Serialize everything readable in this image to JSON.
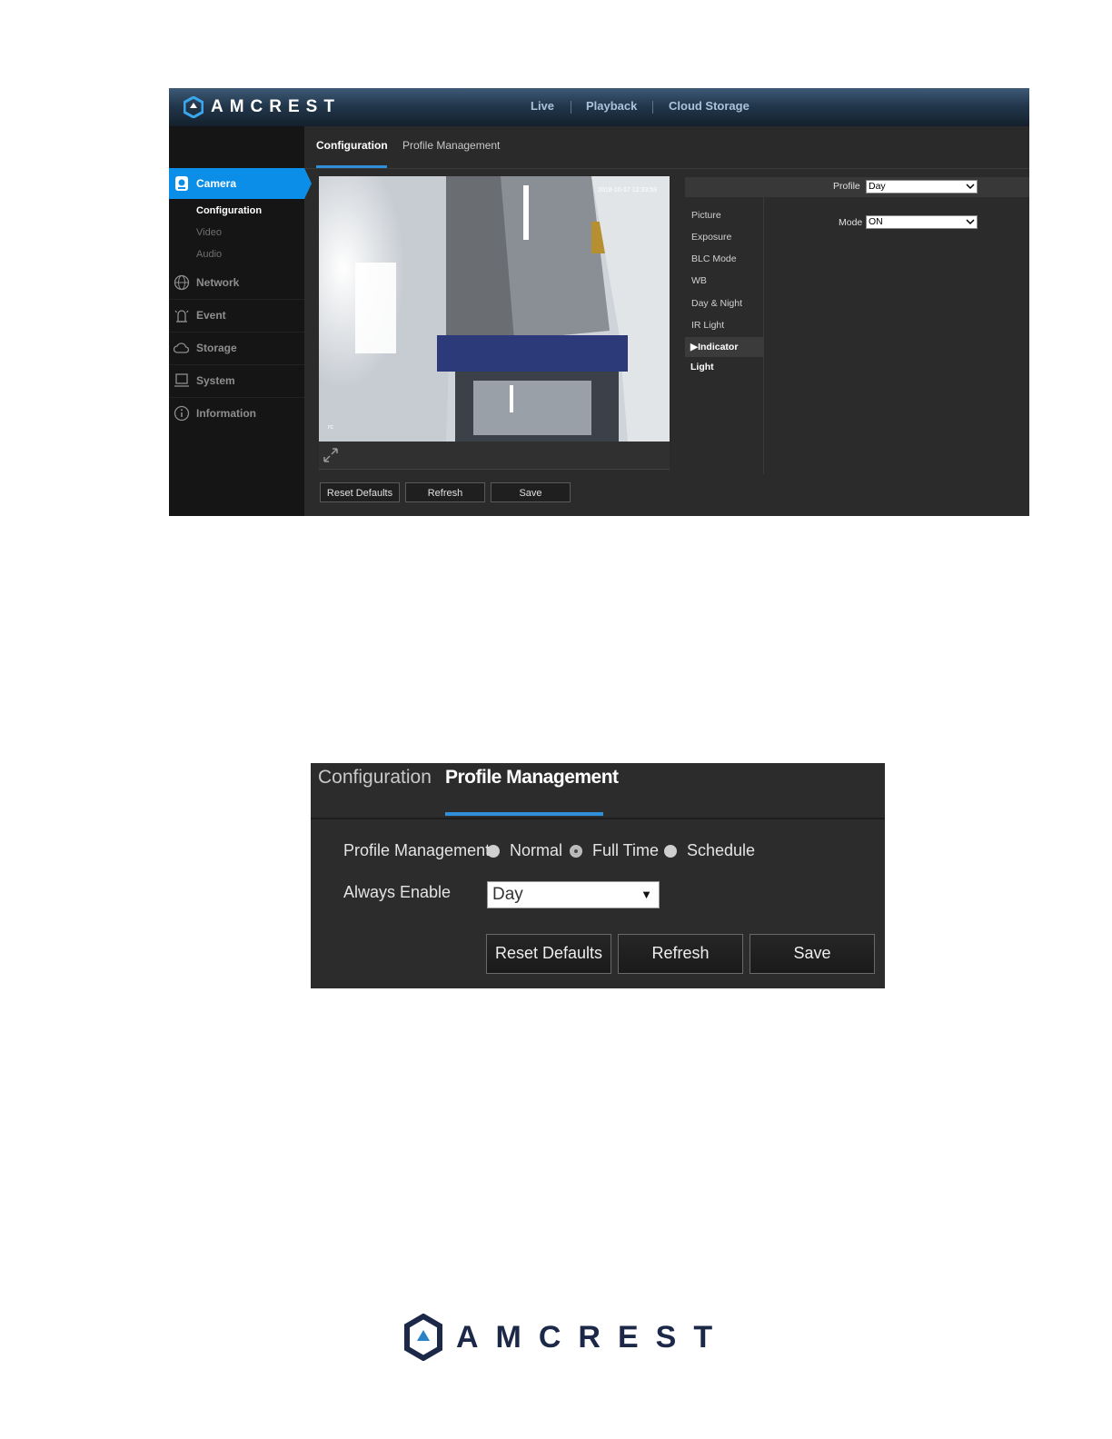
{
  "brand": {
    "name": "AMCREST"
  },
  "screenshot1": {
    "topnav": [
      "Live",
      "Playback",
      "Cloud Storage"
    ],
    "subtabs": {
      "configuration": "Configuration",
      "profile_management": "Profile Management"
    },
    "leftnav": {
      "camera": "Camera",
      "camera_subitems": [
        "Configuration",
        "Video",
        "Audio"
      ],
      "network": "Network",
      "event": "Event",
      "storage": "Storage",
      "system": "System",
      "information": "Information"
    },
    "preview": {
      "timestamp": "2018-10-17 12:33:53",
      "channel_label": "rc"
    },
    "buttons": {
      "reset": "Reset Defaults",
      "refresh": "Refresh",
      "save": "Save"
    },
    "settings": {
      "profile_label": "Profile",
      "profile_value": "Day",
      "items": [
        "Picture",
        "Exposure",
        "BLC Mode",
        "WB",
        "Day & Night",
        "IR Light",
        "Indicator Light"
      ],
      "active_item_prefix": "▶",
      "mode_label": "Mode",
      "mode_value": "ON"
    },
    "colors": {
      "accent": "#0b8ee8",
      "tab_underline": "#2f8fd8"
    }
  },
  "screenshot2": {
    "tabs": {
      "configuration": "Configuration",
      "profile_management": "Profile Management"
    },
    "profile_management_label": "Profile Management",
    "radio_options": [
      "Normal",
      "Full Time",
      "Schedule"
    ],
    "selected_option": "Full Time",
    "always_enable_label": "Always Enable",
    "always_enable_value": "Day",
    "dropdown_arrow": "▼",
    "buttons": {
      "reset": "Reset Defaults",
      "refresh": "Refresh",
      "save": "Save"
    }
  },
  "footer": {
    "logo_text": "AMCREST"
  }
}
